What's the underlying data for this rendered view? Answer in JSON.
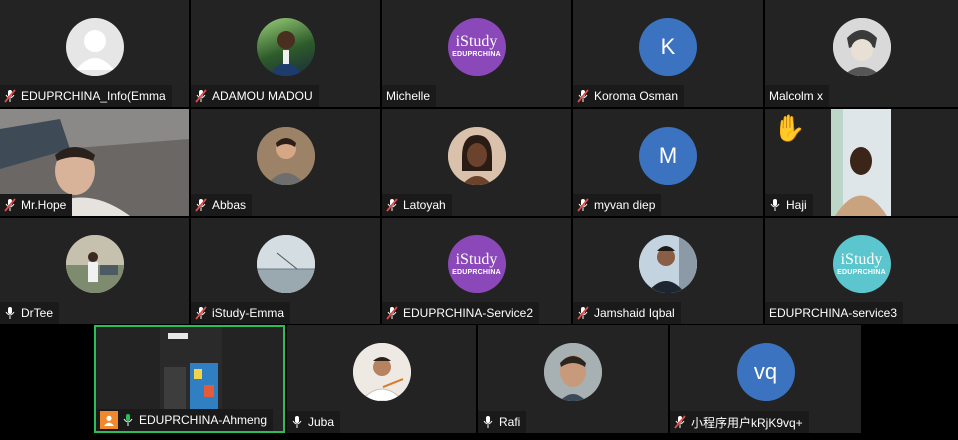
{
  "participants": [
    {
      "name": "EDUPRCHINA_Info(Emma",
      "muted": true
    },
    {
      "name": "ADAMOU MADOU",
      "muted": true
    },
    {
      "name": "Michelle",
      "muted": null
    },
    {
      "name": "Koroma  Osman",
      "muted": true,
      "initials": "K"
    },
    {
      "name": "Malcolm x",
      "muted": null
    },
    {
      "name": "Mr.Hope",
      "muted": true
    },
    {
      "name": "Abbas",
      "muted": true
    },
    {
      "name": "Latoyah",
      "muted": true
    },
    {
      "name": "myvan diep",
      "muted": true,
      "initials": "M"
    },
    {
      "name": "Haji",
      "muted": false,
      "hand_raised": "✋"
    },
    {
      "name": "DrTee",
      "muted": false
    },
    {
      "name": "iStudy-Emma",
      "muted": true
    },
    {
      "name": "EDUPRCHINA-Service2",
      "muted": true
    },
    {
      "name": "Jamshaid Iqbal",
      "muted": true
    },
    {
      "name": "EDUPRCHINA-service3",
      "muted": null
    },
    {
      "name": "EDUPRCHINA-Ahmeng",
      "muted": false,
      "active_speaker": true
    },
    {
      "name": "Juba",
      "muted": false
    },
    {
      "name": "Rafi",
      "muted": false
    },
    {
      "name": "小程序用户kRjK9vq+",
      "muted": true,
      "initials": "vq"
    }
  ],
  "istudy_logo": {
    "line1": "iStudy",
    "line2": "EDUPRCHINA"
  },
  "colors": {
    "tile_bg": "#232323",
    "label_bg": "#1a1a1a",
    "avatar_blue": "#3b73c0",
    "istudy_purple": "#8b48b8",
    "istudy_teal": "#5cc6ce",
    "active_border": "#2bbd5a",
    "muted_red": "#e04b4b"
  }
}
